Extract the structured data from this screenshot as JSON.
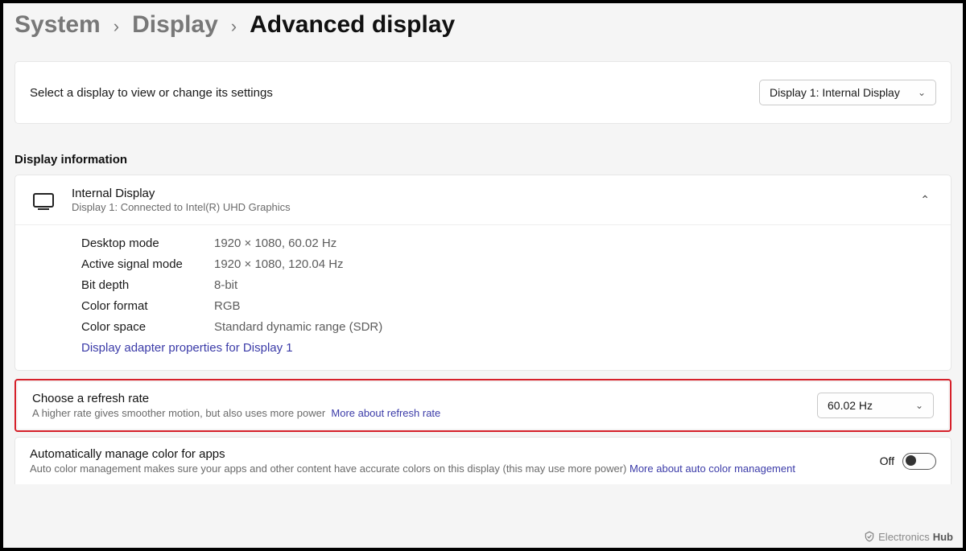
{
  "breadcrumb": {
    "system": "System",
    "display": "Display",
    "current": "Advanced display"
  },
  "select_display": {
    "label": "Select a display to view or change its settings",
    "value": "Display 1: Internal Display"
  },
  "section_title": "Display information",
  "display_info": {
    "title": "Internal Display",
    "subtitle": "Display 1: Connected to Intel(R) UHD Graphics",
    "rows": [
      {
        "k": "Desktop mode",
        "v": "1920 × 1080, 60.02 Hz"
      },
      {
        "k": "Active signal mode",
        "v": "1920 × 1080, 120.04 Hz"
      },
      {
        "k": "Bit depth",
        "v": "8-bit"
      },
      {
        "k": "Color format",
        "v": "RGB"
      },
      {
        "k": "Color space",
        "v": "Standard dynamic range (SDR)"
      }
    ],
    "adapter_link": "Display adapter properties for Display 1"
  },
  "refresh_rate": {
    "title": "Choose a refresh rate",
    "desc": "A higher rate gives smoother motion, but also uses more power",
    "link": "More about refresh rate",
    "value": "60.02 Hz"
  },
  "auto_color": {
    "title": "Automatically manage color for apps",
    "desc": "Auto color management makes sure your apps and other content have accurate colors on this display (this may use more power)",
    "link": "More about auto color management",
    "state_label": "Off"
  },
  "watermark": {
    "brand1": "Electronics",
    "brand2": "Hub"
  }
}
